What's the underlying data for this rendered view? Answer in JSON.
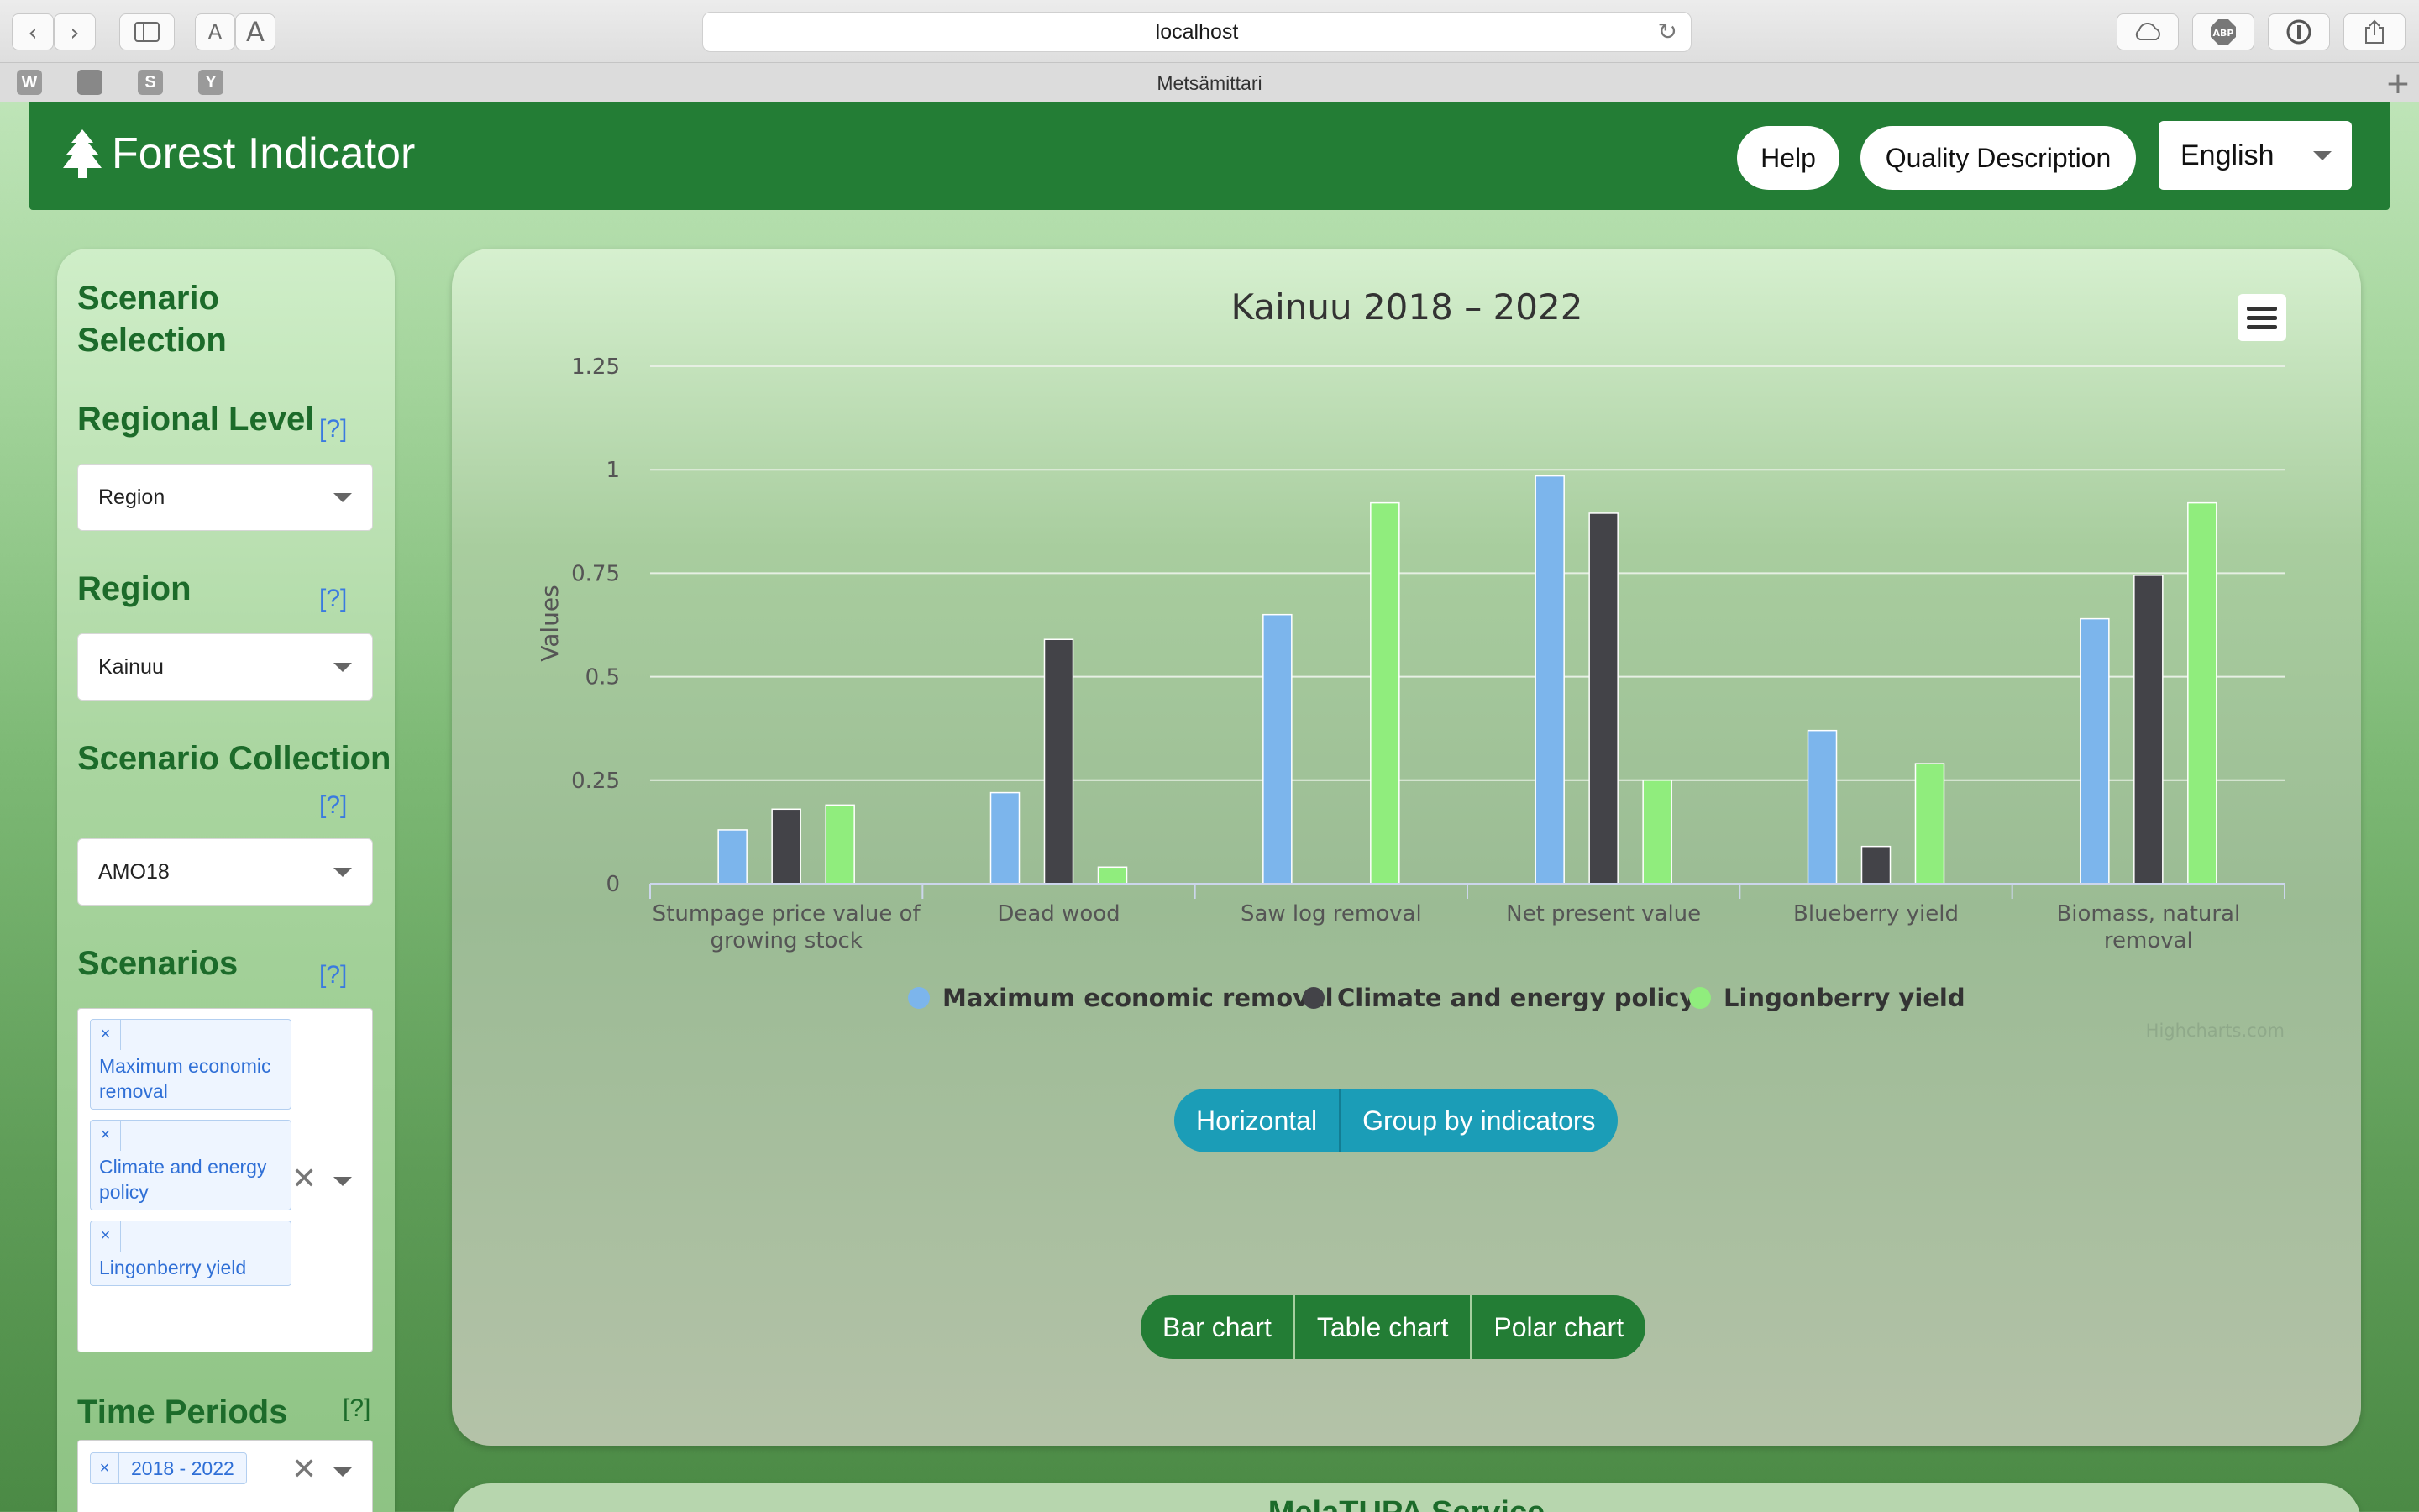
{
  "browser": {
    "url": "localhost",
    "tab_title": "Metsämittari",
    "bookmarks": [
      "W",
      "",
      "S",
      "Y"
    ],
    "reader_small": "A",
    "reader_large": "A"
  },
  "header": {
    "brand": "Forest Indicator",
    "help_label": "Help",
    "quality_label": "Quality Description",
    "language": "English"
  },
  "sidebar": {
    "title": "Scenario Selection",
    "help_text": "[?]",
    "regional_level": {
      "label": "Regional Level",
      "value": "Region"
    },
    "region": {
      "label": "Region",
      "value": "Kainuu"
    },
    "collection": {
      "label": "Scenario Collection",
      "value": "AMO18"
    },
    "scenarios": {
      "label": "Scenarios",
      "chips": [
        "Maximum economic removal",
        "Climate and energy policy",
        "Lingonberry yield"
      ]
    },
    "time_periods": {
      "label": "Time Periods",
      "chips": [
        "2018 - 2022"
      ]
    },
    "remove_symbol": "×",
    "clear_symbol": "✕"
  },
  "chart_controls": {
    "orientation": "Horizontal",
    "grouping": "Group by indicators",
    "chart_types": [
      "Bar chart",
      "Table chart",
      "Polar chart"
    ]
  },
  "next_card": {
    "title": "MelaTUPA Service"
  },
  "chart_data": {
    "type": "bar",
    "title": "Kainuu 2018 – 2022",
    "ylabel": "Values",
    "xlabel": "",
    "credits": "Highcharts.com",
    "ylim": [
      0,
      1.25
    ],
    "yticks": [
      "0",
      "0.25",
      "0.5",
      "0.75",
      "1",
      "1.25"
    ],
    "ytick_values": [
      0,
      0.25,
      0.5,
      0.75,
      1,
      1.25
    ],
    "categories": [
      [
        "Stumpage price value of",
        "growing stock"
      ],
      [
        "Dead wood"
      ],
      [
        "Saw log removal"
      ],
      [
        "Net present value"
      ],
      [
        "Blueberry yield"
      ],
      [
        "Biomass, natural",
        "removal"
      ]
    ],
    "series": [
      {
        "name": "Maximum economic removal",
        "color": "#7cb5ec",
        "values": [
          0.13,
          0.22,
          0.65,
          0.985,
          0.37,
          0.64
        ]
      },
      {
        "name": "Climate and energy policy",
        "color": "#434348",
        "values": [
          0.18,
          0.59,
          0,
          0.895,
          0.09,
          0.745
        ]
      },
      {
        "name": "Lingonberry yield",
        "color": "#90ed7d",
        "values": [
          0.19,
          0.04,
          0.92,
          0.25,
          0.29,
          0.92
        ]
      }
    ],
    "legend_position": "bottom-center",
    "grid": true
  }
}
